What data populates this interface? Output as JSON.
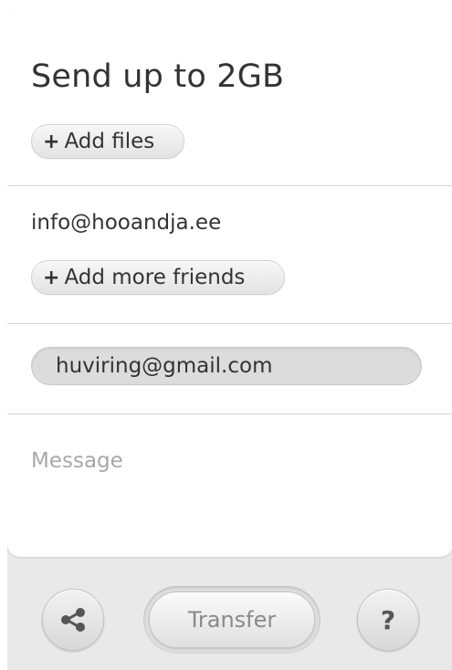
{
  "header": {
    "title": "Send up to 2GB",
    "add_files": {
      "icon": "+",
      "label": "Add files"
    }
  },
  "recipients": {
    "items": [
      "info@hooandja.ee"
    ],
    "add_more": {
      "icon": "+",
      "label": "Add more friends"
    }
  },
  "sender": {
    "email": "huviring@gmail.com"
  },
  "message": {
    "placeholder": "Message"
  },
  "footer": {
    "share_icon": "share-icon",
    "transfer_label": "Transfer",
    "help_label": "?"
  }
}
